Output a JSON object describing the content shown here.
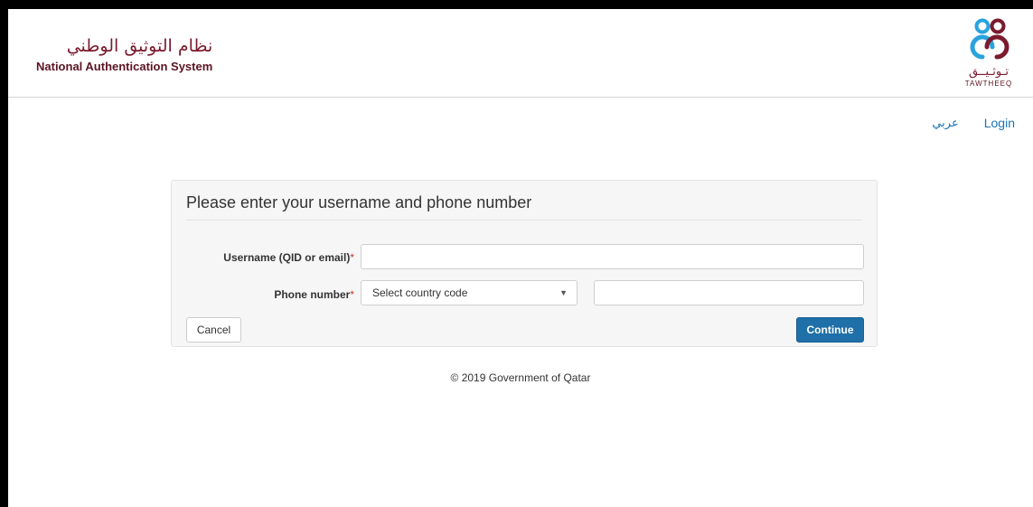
{
  "header": {
    "brand_arabic": "نظام التوثيق الوطني",
    "brand_english": "National Authentication System",
    "logo_arabic": "تـوثـيــق",
    "logo_english": "TAWTHEEQ"
  },
  "topnav": {
    "arabic_link": "عربي",
    "login_link": "Login"
  },
  "form": {
    "title": "Please enter your username and phone number",
    "username_label": "Username (QID or email)",
    "phone_label": "Phone number",
    "required_mark": "*",
    "username_value": "",
    "phone_value": "",
    "country_select": {
      "selected": "Select country code"
    },
    "cancel_label": "Cancel",
    "continue_label": "Continue"
  },
  "footer": {
    "copyright": "© 2019 Government of Qatar"
  },
  "colors": {
    "brand": "#7b1a2e",
    "link": "#1a73b5",
    "primary_button": "#1f6fa8",
    "required": "#c0392b"
  },
  "icons": {
    "logo": "tawtheeq-logo-icon",
    "select_caret": "caret-down-icon"
  }
}
